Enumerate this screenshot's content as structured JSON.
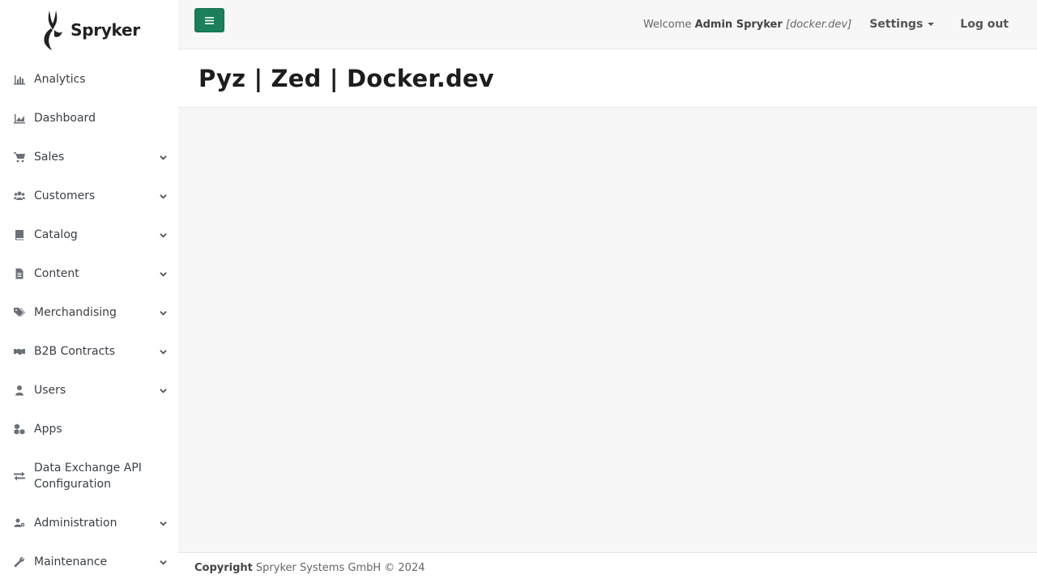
{
  "brand": {
    "name": "Spryker"
  },
  "sidebar": {
    "items": [
      {
        "label": "Analytics",
        "icon": "bar-chart-icon",
        "expandable": false
      },
      {
        "label": "Dashboard",
        "icon": "area-chart-icon",
        "expandable": false
      },
      {
        "label": "Sales",
        "icon": "shopping-cart-icon",
        "expandable": true
      },
      {
        "label": "Customers",
        "icon": "users-icon",
        "expandable": true
      },
      {
        "label": "Catalog",
        "icon": "book-icon",
        "expandable": true
      },
      {
        "label": "Content",
        "icon": "file-text-icon",
        "expandable": true
      },
      {
        "label": "Merchandising",
        "icon": "tags-icon",
        "expandable": true
      },
      {
        "label": "B2B Contracts",
        "icon": "handshake-icon",
        "expandable": true
      },
      {
        "label": "Users",
        "icon": "user-icon",
        "expandable": true
      },
      {
        "label": "Apps",
        "icon": "cubes-icon",
        "expandable": false
      },
      {
        "label": "Data Exchange API Configuration",
        "icon": "exchange-icon",
        "expandable": false
      },
      {
        "label": "Administration",
        "icon": "users-cog-icon",
        "expandable": true
      },
      {
        "label": "Maintenance",
        "icon": "wrench-icon",
        "expandable": true
      }
    ]
  },
  "topbar": {
    "welcome_prefix": "Welcome",
    "user_name": "Admin Spryker",
    "environment": "[docker.dev]",
    "settings_label": "Settings",
    "logout_label": "Log out"
  },
  "page": {
    "title": "Pyz | Zed | Docker.dev"
  },
  "footer": {
    "copyright_label": "Copyright",
    "copyright_text": "Spryker Systems GmbH © 2024"
  },
  "colors": {
    "accent": "#1a7f5a",
    "background": "#f7f7f7",
    "sidebar": "#ffffff"
  }
}
